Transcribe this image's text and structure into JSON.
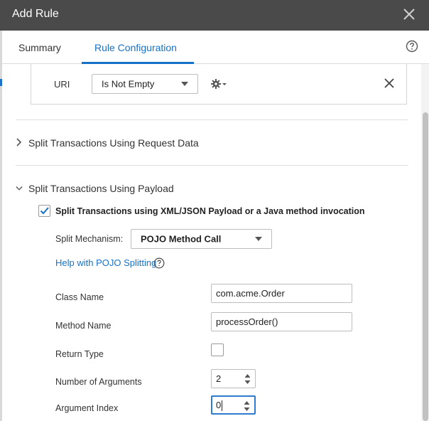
{
  "window": {
    "title": "Add Rule"
  },
  "tabs": [
    {
      "label": "Summary"
    },
    {
      "label": "Rule Configuration"
    }
  ],
  "uri_condition": {
    "label": "URI",
    "operator": "Is Not Empty"
  },
  "sections": {
    "request_data": {
      "title": "Split Transactions Using Request Data",
      "expanded": false
    },
    "payload": {
      "title": "Split Transactions Using Payload",
      "expanded": true,
      "checkbox_label": "Split Transactions using XML/JSON Payload or a Java method invocation",
      "checked": true,
      "mechanism_label": "Split Mechanism:",
      "mechanism_value": "POJO Method Call",
      "help_link": "Help with POJO Splitting",
      "fields": {
        "class_name_label": "Class Name",
        "class_name_value": "com.acme.Order",
        "method_name_label": "Method Name",
        "method_name_value": "processOrder()",
        "return_type_label": "Return Type",
        "num_args_label": "Number of Arguments",
        "num_args_value": "2",
        "arg_index_label": "Argument Index",
        "arg_index_value": "0"
      }
    }
  },
  "colors": {
    "accent": "#1672c9",
    "titlebar": "#4a4a4a"
  }
}
